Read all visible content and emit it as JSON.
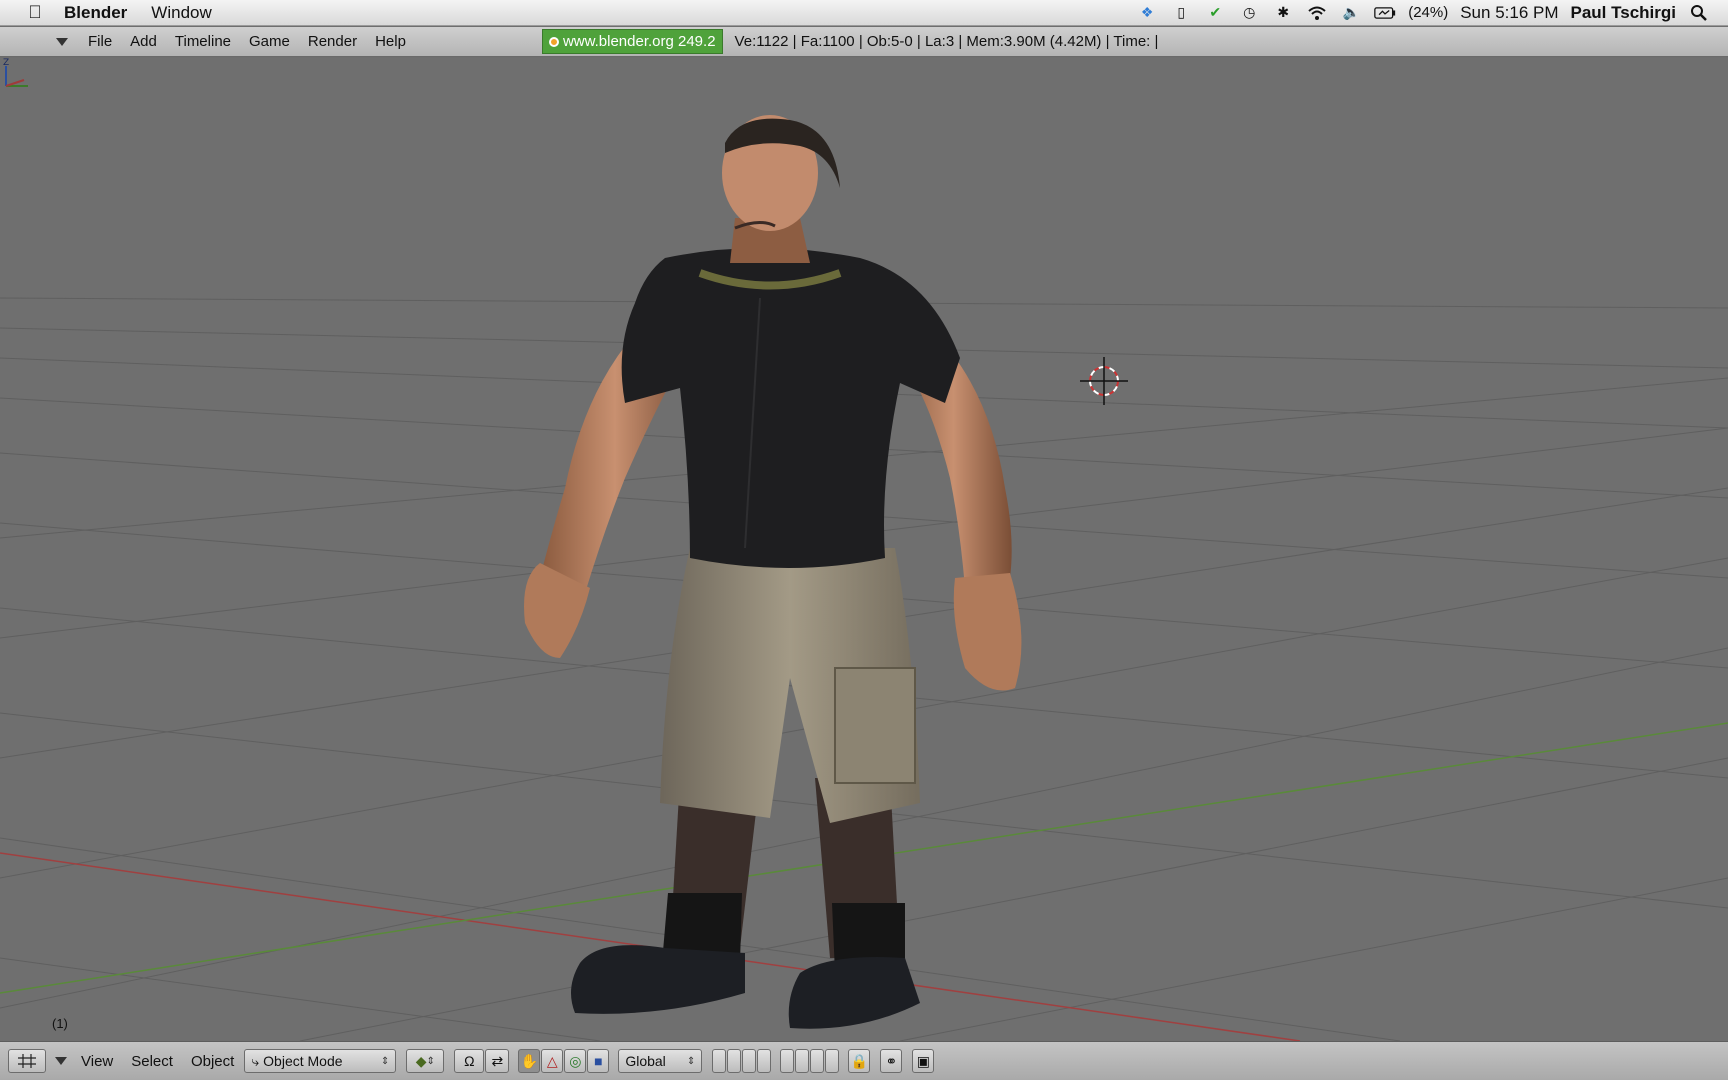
{
  "macbar": {
    "app_name": "Blender",
    "menus": [
      "Window"
    ],
    "battery": "(24%)",
    "clock": "Sun 5:16 PM",
    "user": "Paul Tschirgi",
    "tray_icons": [
      "dropbox-icon",
      "phone-icon",
      "cloud-check-icon",
      "time-machine-icon",
      "bluetooth-icon",
      "wifi-icon",
      "volume-icon",
      "battery-icon"
    ]
  },
  "infobar": {
    "menus": [
      "File",
      "Add",
      "Timeline",
      "Game",
      "Render",
      "Help"
    ],
    "version": "www.blender.org 249.2",
    "stats": "Ve:1122 | Fa:1100 | Ob:5-0 | La:3  | Mem:3.90M (4.42M)  | Time: |"
  },
  "viewport": {
    "frame": "(1)",
    "axis_label": "Z"
  },
  "bottombar": {
    "menus": [
      "View",
      "Select",
      "Object"
    ],
    "mode": "Object Mode",
    "orientation": "Global"
  },
  "colors": {
    "version_bg": "#4fa23b",
    "viewport_bg": "#6f6f6f",
    "x_axis": "#a04040",
    "y_axis": "#5a8a3a"
  }
}
